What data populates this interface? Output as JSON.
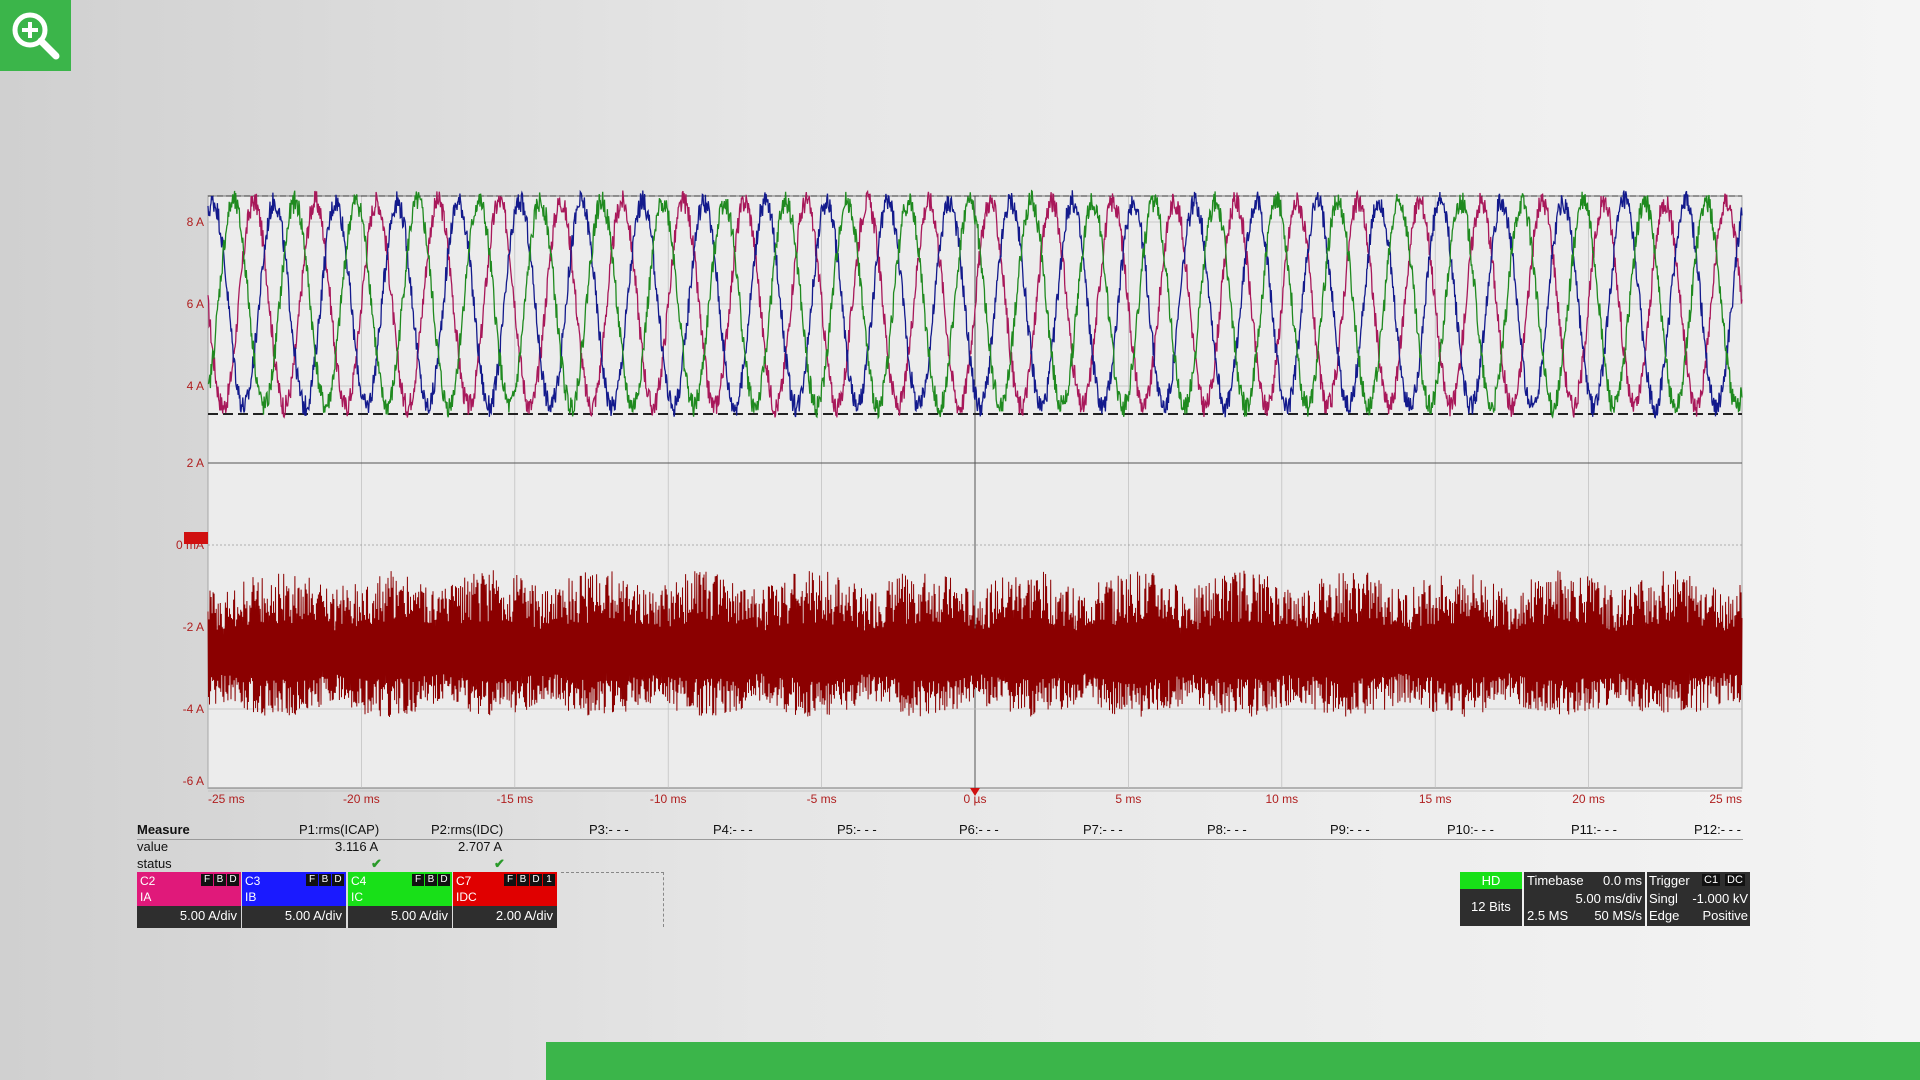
{
  "colors": {
    "accent_green": "#3bb54a",
    "c2_magenta": "#a8185a",
    "c3_blue": "#131a8c",
    "c4_green": "#1f8a1f",
    "c7_red": "#8b0000"
  },
  "icons": {
    "zoom": "zoom-in-icon"
  },
  "chart_data": {
    "type": "line",
    "xlabel": "",
    "ylabel": "",
    "xlim": [
      -25,
      25
    ],
    "ylim": [
      -6,
      8
    ],
    "grid": true,
    "x_ticks": [
      "-25 ms",
      "-20 ms",
      "-15 ms",
      "-10 ms",
      "-5 ms",
      "0 µs",
      "5 ms",
      "10 ms",
      "15 ms",
      "20 ms",
      "25 ms"
    ],
    "upper_y_ticks": [
      "8 A",
      "6 A",
      "4 A"
    ],
    "lower_y_ticks": [
      "2 A",
      "0 mA",
      "-2 A",
      "-4 A",
      "-6 A"
    ],
    "x_unit": "ms",
    "series": [
      {
        "name": "IA",
        "channel": "C2",
        "color": "#a8185a",
        "shape": "sine",
        "frequency_hz": 500,
        "phase_deg": 0,
        "min": 3.5,
        "max": 8.5
      },
      {
        "name": "IB",
        "channel": "C3",
        "color": "#131a8c",
        "shape": "sine",
        "frequency_hz": 500,
        "phase_deg": -120,
        "min": 3.5,
        "max": 8.5
      },
      {
        "name": "IC",
        "channel": "C4",
        "color": "#1f8a1f",
        "shape": "sine",
        "frequency_hz": 500,
        "phase_deg": 120,
        "min": 3.5,
        "max": 8.5
      },
      {
        "name": "IDC",
        "channel": "C7",
        "color": "#8b0000",
        "shape": "noise",
        "mean": -2.7,
        "min": -4.2,
        "max": -0.6
      }
    ]
  },
  "measure": {
    "header_label": "Measure",
    "value_label": "value",
    "status_label": "status",
    "params": [
      {
        "name": "P1:rms(ICAP)",
        "value": "3.116 A",
        "status": "✔"
      },
      {
        "name": "P2:rms(IDC)",
        "value": "2.707 A",
        "status": "✔"
      },
      {
        "name": "P3:- - -"
      },
      {
        "name": "P4:- - -"
      },
      {
        "name": "P5:- - -"
      },
      {
        "name": "P6:- - -"
      },
      {
        "name": "P7:- - -"
      },
      {
        "name": "P8:- - -"
      },
      {
        "name": "P9:- - -"
      },
      {
        "name": "P10:- - -"
      },
      {
        "name": "P11:- - -"
      },
      {
        "name": "P12:- - -"
      }
    ]
  },
  "channels": [
    {
      "id": "C2",
      "signal": "IA",
      "scale": "5.00 A/div",
      "color": "#e0197a",
      "flags": [
        "F",
        "B",
        "D"
      ]
    },
    {
      "id": "C3",
      "signal": "IB",
      "scale": "5.00 A/div",
      "color": "#1a1aff",
      "flags": [
        "F",
        "B",
        "D"
      ]
    },
    {
      "id": "C4",
      "signal": "IC",
      "scale": "5.00 A/div",
      "color": "#18e018",
      "flags": [
        "F",
        "B",
        "D"
      ]
    },
    {
      "id": "C7",
      "signal": "IDC",
      "scale": "2.00 A/div",
      "color": "#e00000",
      "flags": [
        "F",
        "B",
        "D",
        "1"
      ]
    }
  ],
  "acquisition": {
    "mode": "HD",
    "bits": "12 Bits",
    "timebase_label": "Timebase",
    "timebase_delay": "0.0 ms",
    "time_per_div": "5.00 ms/div",
    "samples": "2.5 MS",
    "sample_rate": "50 MS/s"
  },
  "trigger": {
    "label": "Trigger",
    "source": "C1",
    "coupling": "DC",
    "mode": "Singl",
    "level": "-1.000 kV",
    "type": "Edge",
    "slope": "Positive"
  }
}
